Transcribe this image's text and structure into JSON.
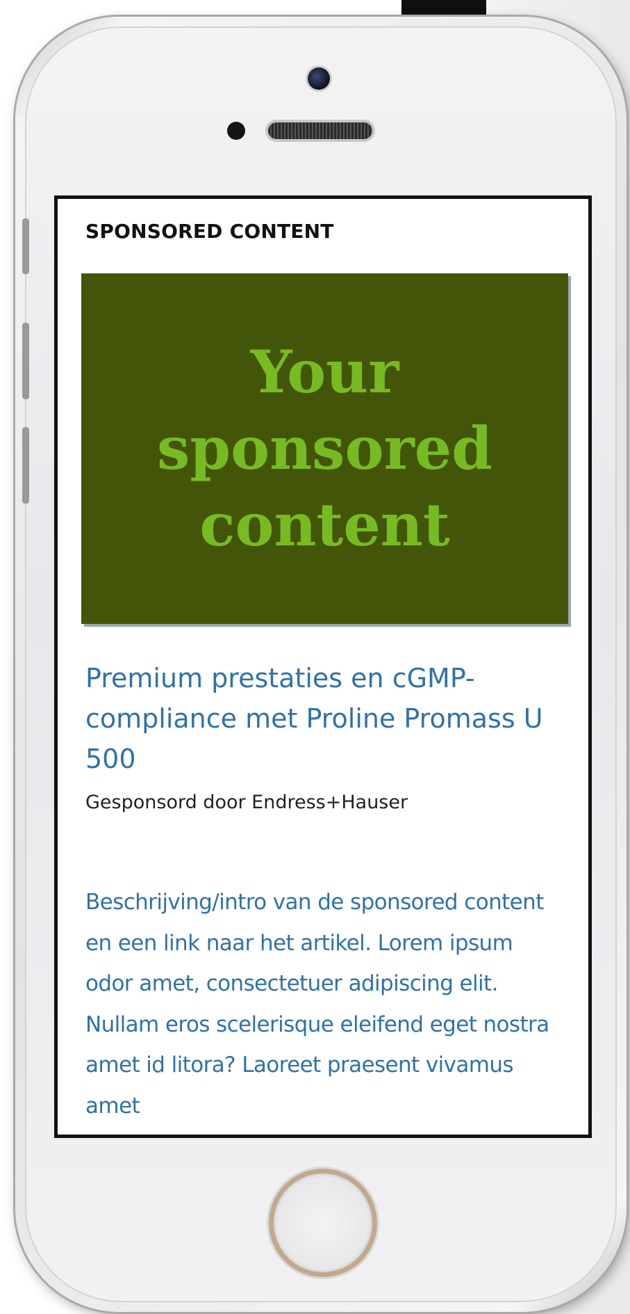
{
  "screen": {
    "section_label": "SPONSORED CONTENT",
    "hero": {
      "text": "Your sponsored content",
      "background_color": "#435508",
      "text_color": "#77bb22"
    },
    "headline": "Premium prestaties en cGMP-compliance met Proline Promass U 500",
    "sponsor": "Gesponsord door Endress+Hauser",
    "description": "Beschrijving/intro van de sponsored content en een link naar het artikel. Lorem ipsum odor amet, consectetuer adipiscing elit. Nullam eros scelerisque eleifend eget nostra amet id litora? Laoreet praesent vivamus amet",
    "link_color": "#2f72a8"
  }
}
